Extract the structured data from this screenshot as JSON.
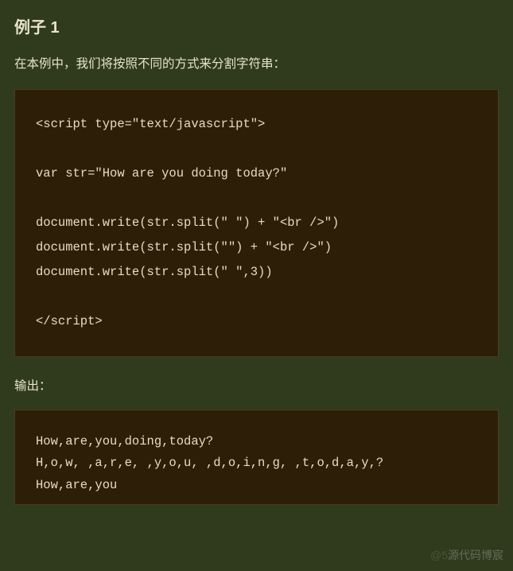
{
  "heading": "例子 1",
  "intro": "在本例中，我们将按照不同的方式来分割字符串：",
  "code": "<script type=\"text/javascript\">\n\nvar str=\"How are you doing today?\"\n\ndocument.write(str.split(\" \") + \"<br />\")\ndocument.write(str.split(\"\") + \"<br />\")\ndocument.write(str.split(\" \",3))\n\n</script>",
  "output_label": "输出：",
  "output": "How,are,you,doing,today?\nH,o,w, ,a,r,e, ,y,o,u, ,d,o,i,n,g, ,t,o,d,a,y,?\nHow,are,you",
  "watermark_faded": "@5",
  "watermark_text": "源代码博宸"
}
